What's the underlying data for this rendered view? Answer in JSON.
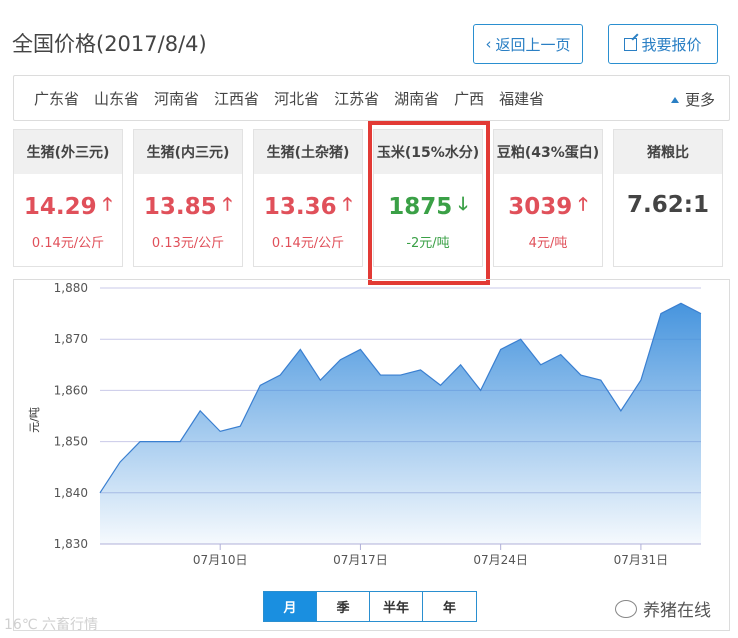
{
  "page": {
    "title": "全国价格(2017/8/4)",
    "back_label": "返回上一页",
    "report_label": "我要报价"
  },
  "provinces": [
    "广东省",
    "山东省",
    "河南省",
    "江西省",
    "河北省",
    "江苏省",
    "湖南省",
    "广西",
    "福建省"
  ],
  "more_label": "更多",
  "cards": [
    {
      "name": "生猪(外三元)",
      "value": "14.29",
      "change": "0.14元/公斤",
      "trend": "up"
    },
    {
      "name": "生猪(内三元)",
      "value": "13.85",
      "change": "0.13元/公斤",
      "trend": "up"
    },
    {
      "name": "生猪(土杂猪)",
      "value": "13.36",
      "change": "0.14元/公斤",
      "trend": "up"
    },
    {
      "name": "玉米(15%水分)",
      "value": "1875",
      "change": "-2元/吨",
      "trend": "down"
    },
    {
      "name": "豆粕(43%蛋白)",
      "value": "3039",
      "change": "4元/吨",
      "trend": "up"
    },
    {
      "name": "猪粮比",
      "value": "7.62:1",
      "change": "",
      "trend": "none"
    }
  ],
  "chart_data": {
    "type": "area",
    "ylabel": "元/吨",
    "ylim": [
      1830,
      1880
    ],
    "yticks": [
      "1,880",
      "1,870",
      "1,860",
      "1,850",
      "1,840",
      "1,830"
    ],
    "xticks": [
      {
        "label": "07月10日",
        "index": 6
      },
      {
        "label": "07月17日",
        "index": 13
      },
      {
        "label": "07月24日",
        "index": 20
      },
      {
        "label": "07月31日",
        "index": 27
      }
    ],
    "values": [
      1840,
      1846,
      1850,
      1850,
      1850,
      1856,
      1852,
      1853,
      1861,
      1863,
      1868,
      1862,
      1866,
      1868,
      1863,
      1863,
      1864,
      1861,
      1865,
      1860,
      1868,
      1870,
      1865,
      1867,
      1863,
      1862,
      1856,
      1862,
      1875,
      1877,
      1875
    ],
    "color": "#3d8fdc"
  },
  "ranges": [
    "月",
    "季",
    "半年",
    "年"
  ],
  "active_range": "月",
  "watermark_left": "16℃ 六畜行情",
  "watermark_right": "养猪在线"
}
